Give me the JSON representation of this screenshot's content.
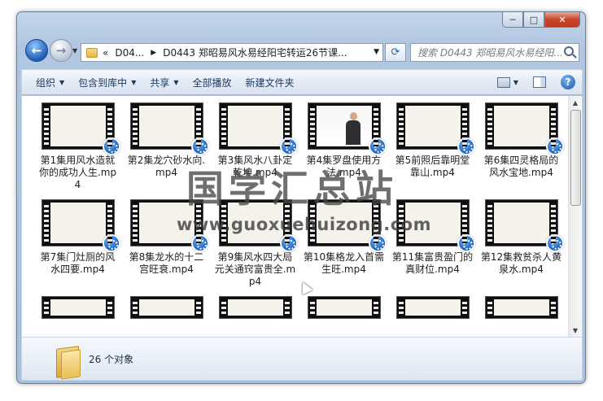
{
  "window": {
    "caption_buttons": {
      "minimize": "─",
      "maximize": "□",
      "close": "✕"
    }
  },
  "address": {
    "overflow": "«",
    "crumbs": [
      "D04...",
      "D0443 郑昭易风水易经阳宅转运26节课..."
    ],
    "search_placeholder": "搜索 D0443 郑昭易风水易经阳..."
  },
  "toolbar": {
    "organize": "组织",
    "include": "包含到库中",
    "share": "共享",
    "play_all": "全部播放",
    "new_folder": "新建文件夹",
    "help": "?"
  },
  "files": [
    {
      "name": "第1集用风水造就你的成功人生.mp4",
      "thumb": "light"
    },
    {
      "name": "第2集龙穴砂水向.mp4",
      "thumb": "light"
    },
    {
      "name": "第3集风水八卦定乾坤.mp4",
      "thumb": "light"
    },
    {
      "name": "第4集罗盘使用方法.mp4",
      "thumb": "person"
    },
    {
      "name": "第5前照后靠明堂靠山.mp4",
      "thumb": "light"
    },
    {
      "name": "第6集四灵格局的风水宝地.mp4",
      "thumb": "light"
    },
    {
      "name": "第7集门灶厕的风水四要.mp4",
      "thumb": "light"
    },
    {
      "name": "第8集龙水的十二宫旺衰.mp4",
      "thumb": "light"
    },
    {
      "name": "第9集风水四大局元关通窍富贵全.mp4",
      "thumb": "light"
    },
    {
      "name": "第10集格龙入首需生旺.mp4",
      "thumb": "light"
    },
    {
      "name": "第11集富贵盈门的真财位.mp4",
      "thumb": "light"
    },
    {
      "name": "第12集救贫杀人黄泉水.mp4",
      "thumb": "light"
    }
  ],
  "details": {
    "count": "26 个对象"
  },
  "watermark": {
    "chinese": "国学汇总站",
    "url": "www.guoxuehuizong.com"
  }
}
